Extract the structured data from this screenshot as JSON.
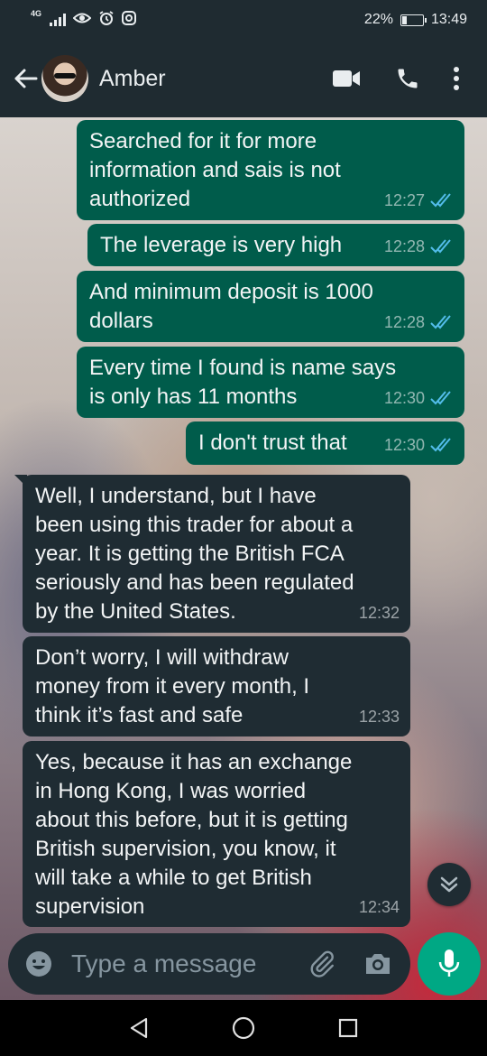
{
  "status_bar": {
    "network": "4G",
    "battery_percent": "22%",
    "battery_level": 0.22,
    "time": "13:49",
    "icons": [
      "signal-icon",
      "eye-icon",
      "alarm-icon",
      "instagram-icon",
      "battery-icon"
    ]
  },
  "header": {
    "contact_name": "Amber",
    "icons": [
      "back-arrow-icon",
      "video-call-icon",
      "voice-call-icon",
      "more-options-icon"
    ]
  },
  "messages": [
    {
      "direction": "outgoing",
      "lines": [
        "Searched for it for more",
        "information and sais is not",
        "authorized"
      ],
      "time": "12:27",
      "status": "read"
    },
    {
      "direction": "outgoing",
      "lines": [
        "The leverage is very high"
      ],
      "time": "12:28",
      "status": "read"
    },
    {
      "direction": "outgoing",
      "lines": [
        "And minimum deposit is 1000",
        "dollars"
      ],
      "time": "12:28",
      "status": "read"
    },
    {
      "direction": "outgoing",
      "lines": [
        "Every time I found is name says",
        "is only has 11 months"
      ],
      "time": "12:30",
      "status": "read"
    },
    {
      "direction": "outgoing",
      "lines": [
        "I don't trust that"
      ],
      "time": "12:30",
      "status": "read"
    },
    {
      "direction": "incoming",
      "lines": [
        "Well, I understand, but I have",
        "been using this trader for about a",
        "year. It is getting the British FCA",
        "seriously and has been regulated",
        "by the United States."
      ],
      "time": "12:32"
    },
    {
      "direction": "incoming",
      "lines": [
        "Don’t worry, I will withdraw",
        "money from it every month, I",
        "think it’s fast and safe"
      ],
      "time": "12:33"
    },
    {
      "direction": "incoming",
      "lines": [
        "Yes, because it has an exchange",
        "in Hong Kong, I was worried",
        "about this before, but it is getting",
        "British supervision, you know, it",
        "will take a while to get British",
        "supervision"
      ],
      "time": "12:34"
    }
  ],
  "composer": {
    "placeholder": "Type a message",
    "icons": [
      "emoji-icon",
      "attach-icon",
      "camera-icon",
      "mic-icon"
    ]
  },
  "colors": {
    "outgoing_bubble": "#005c4b",
    "incoming_bubble": "#1f2c33",
    "header": "#1f2b31",
    "accent": "#00a884",
    "read_ticks": "#53bdeb"
  }
}
